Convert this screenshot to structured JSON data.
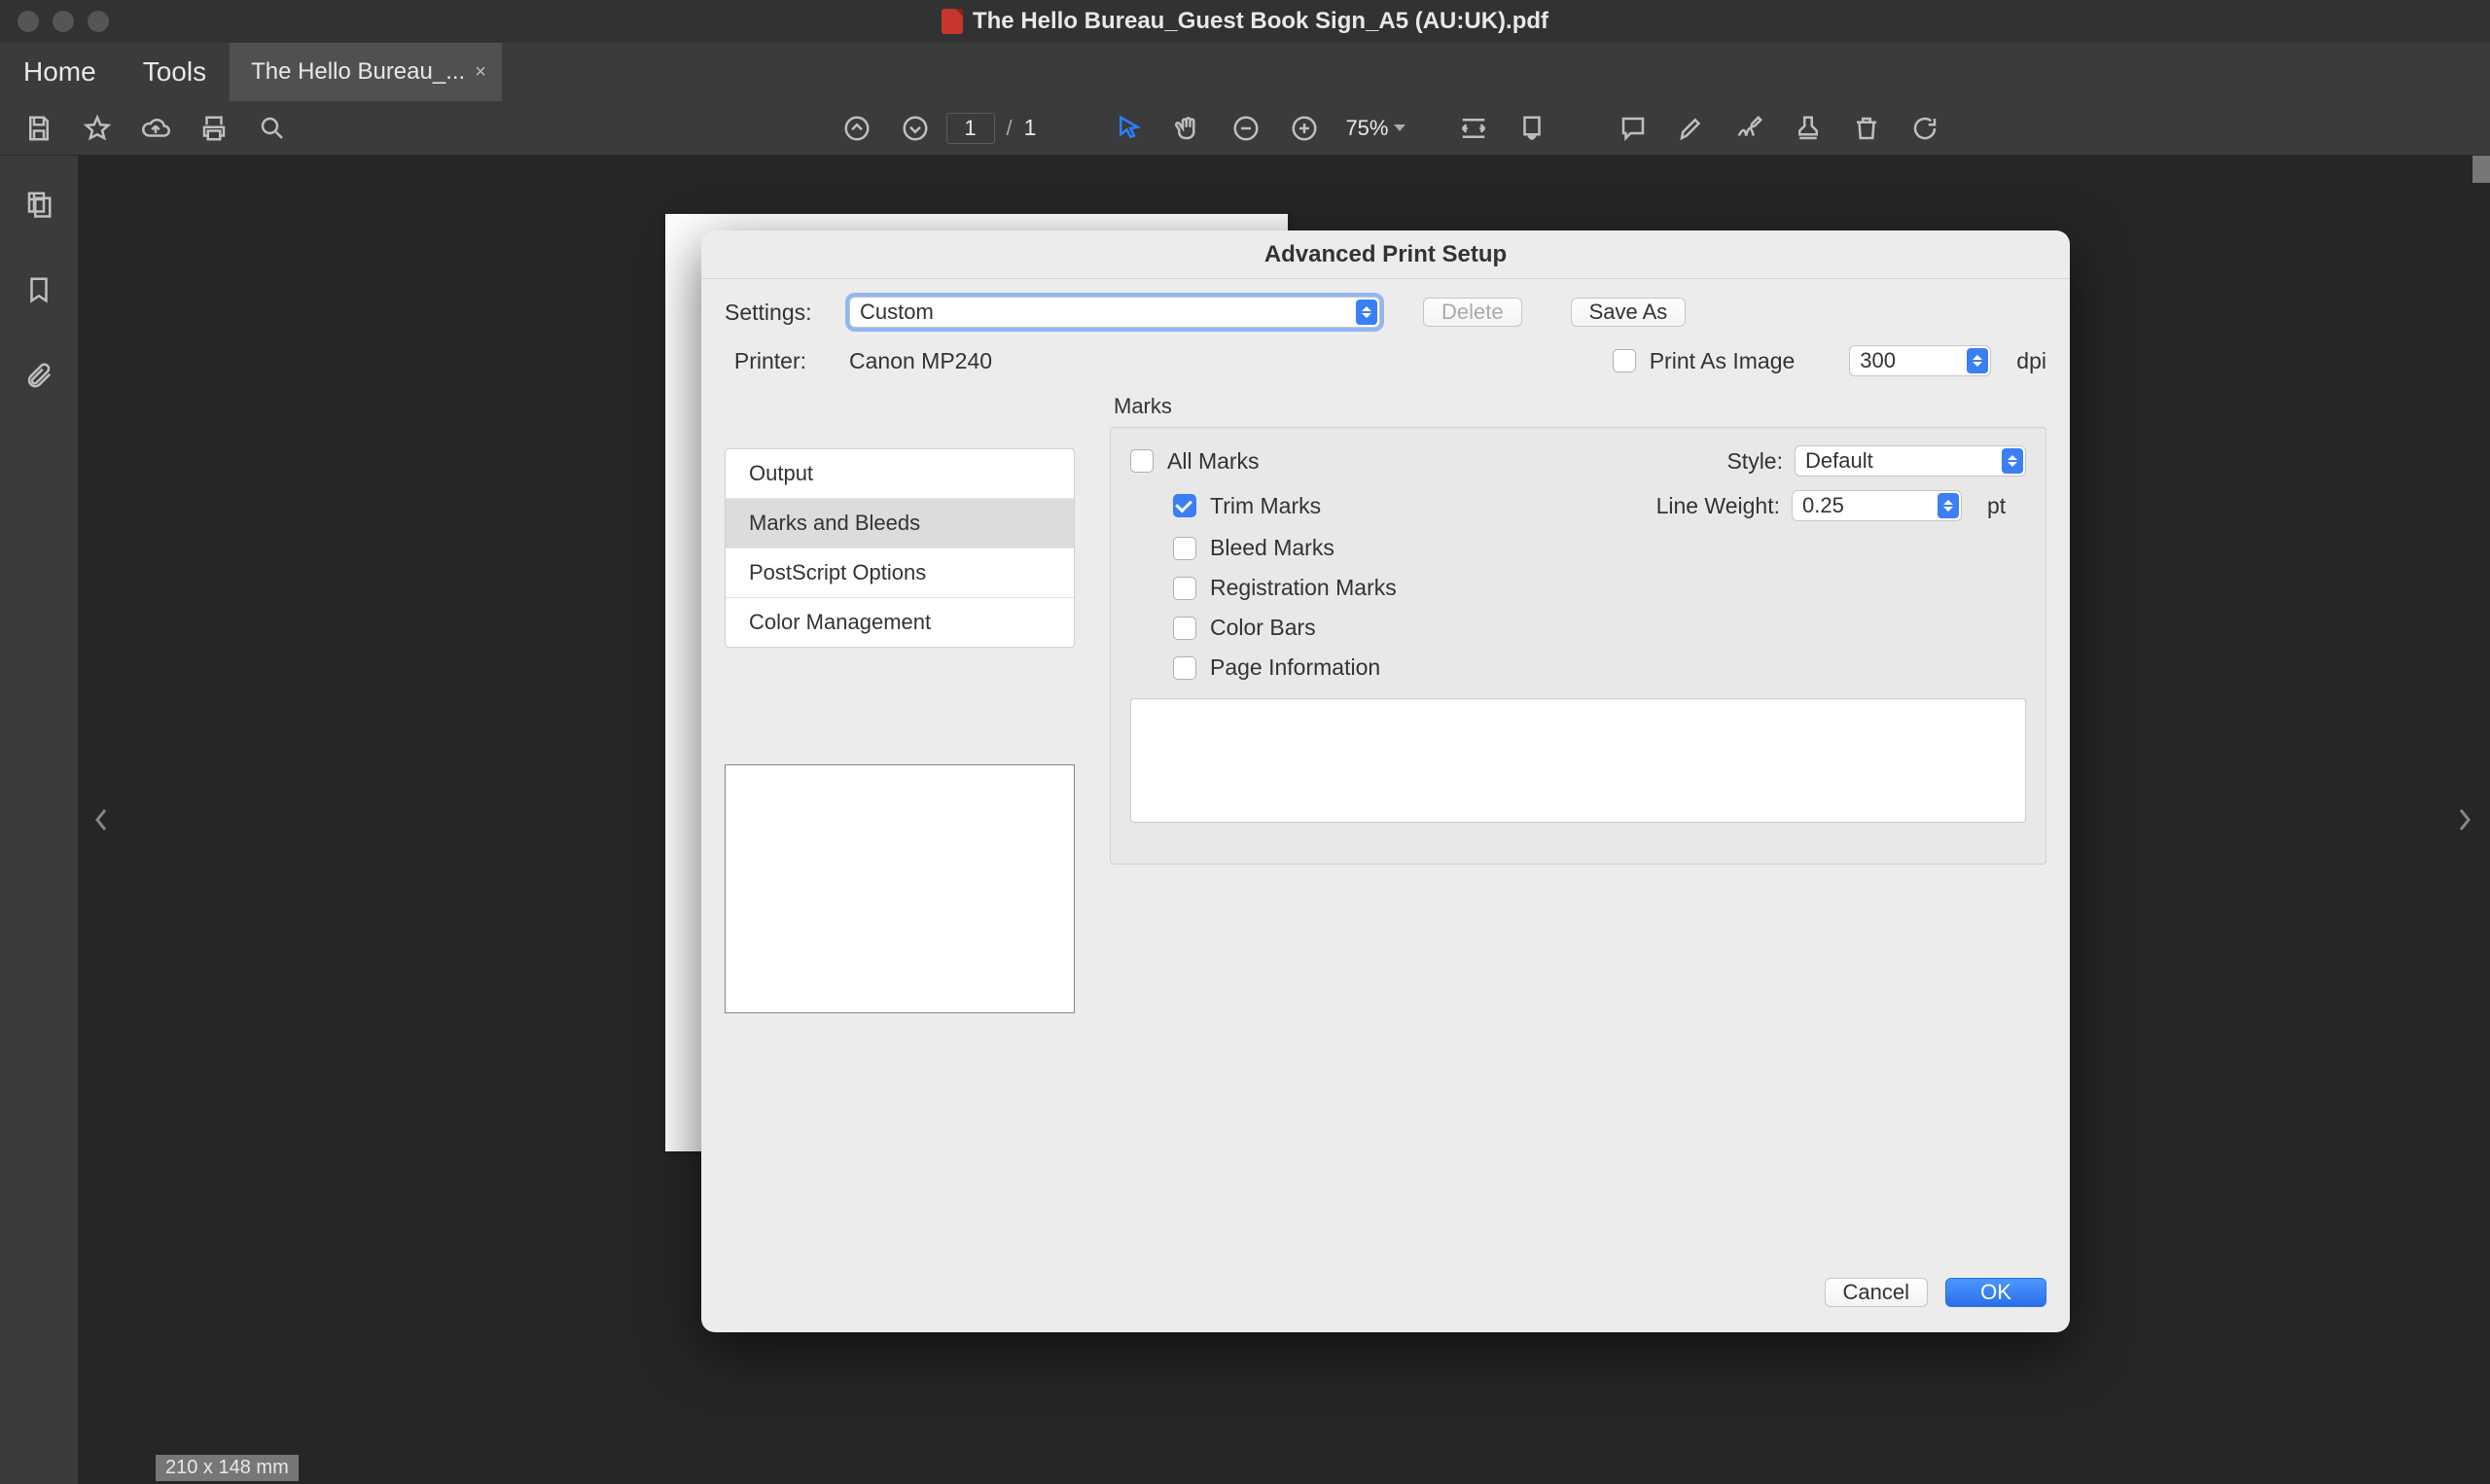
{
  "window": {
    "title": "The Hello Bureau_Guest Book Sign_A5 (AU:UK).pdf"
  },
  "tabs": {
    "home": "Home",
    "tools": "Tools",
    "document": "The Hello Bureau_..."
  },
  "toolbar": {
    "page_current": "1",
    "page_total": "1",
    "page_separator": "/",
    "zoom": "75%"
  },
  "status": {
    "dimensions": "210 x 148 mm"
  },
  "dialog": {
    "title": "Advanced Print Setup",
    "settings_label": "Settings:",
    "settings_value": "Custom",
    "btn_delete": "Delete",
    "btn_saveas": "Save As",
    "printer_label": "Printer:",
    "printer_value": "Canon MP240",
    "print_as_image": "Print As Image",
    "dpi_value": "300",
    "dpi_unit": "dpi",
    "categories": {
      "output": "Output",
      "marks_bleeds": "Marks and Bleeds",
      "postscript": "PostScript Options",
      "color_mgmt": "Color Management"
    },
    "marks": {
      "heading": "Marks",
      "all_marks": "All Marks",
      "trim_marks": "Trim Marks",
      "bleed_marks": "Bleed Marks",
      "registration_marks": "Registration Marks",
      "color_bars": "Color Bars",
      "page_information": "Page Information",
      "style_label": "Style:",
      "style_value": "Default",
      "line_weight_label": "Line Weight:",
      "line_weight_value": "0.25",
      "line_weight_unit": "pt"
    },
    "btn_cancel": "Cancel",
    "btn_ok": "OK"
  }
}
